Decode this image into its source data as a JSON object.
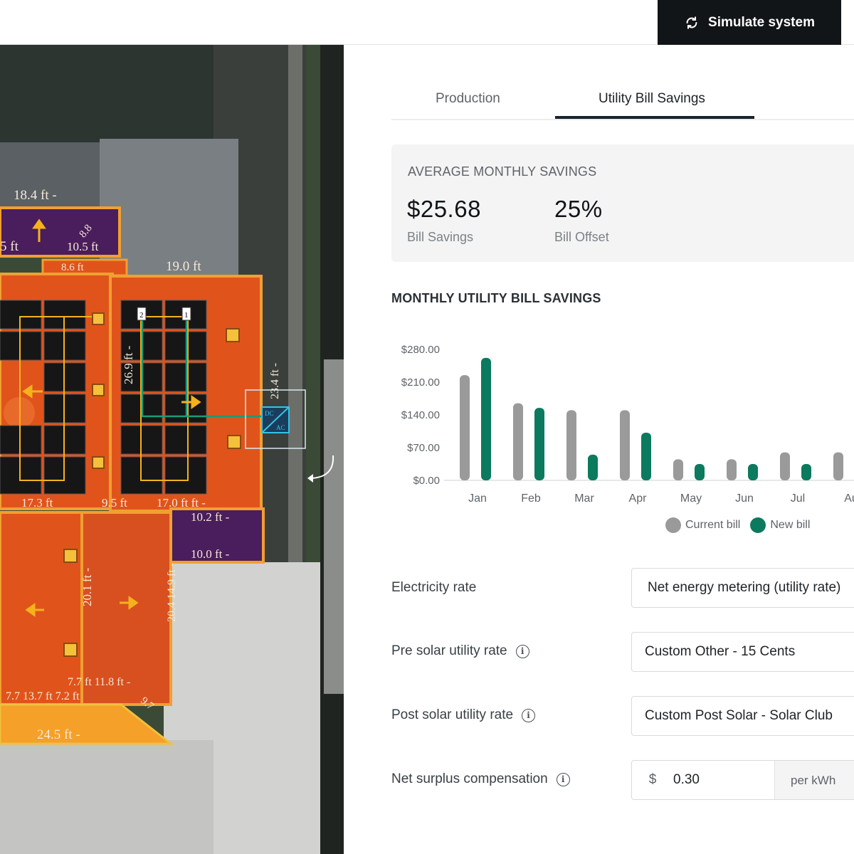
{
  "toolbar": {
    "simulate_label": "Simulate system"
  },
  "colors": {
    "current_bill": "#9a9a9a",
    "new_bill": "#0b7a5e",
    "dark": "#121517",
    "roof": "#e0541c",
    "solar_panel": "#161616"
  },
  "map": {
    "labels": {
      "l1": "18.4 ft -",
      "l2": "5 ft",
      "l3": "8.8",
      "l4": "10.5 ft",
      "l5": "8.6 ft",
      "l6": "19.0 ft",
      "l7": "26.9 ft -",
      "l8": "23.4 ft -",
      "l9": "17.3 ft",
      "l10": "9.5 ft",
      "l11": "17.0 ft ft -",
      "l12": "10.2 ft -",
      "l13": "10.0 ft -",
      "l14": "20.1 ft -",
      "l15": "20.4 14.9 ft -",
      "l16": "7.7 ft 11.8 ft -",
      "l17": "7.7 13.7 ft 7.2 ft",
      "l18": "9.7",
      "l19": "24.5 ft -",
      "string_1": "1",
      "string_2": "2",
      "inverter_dc": "DC",
      "inverter_ac": "AC"
    }
  },
  "tabs": [
    {
      "label": "Production",
      "active": false
    },
    {
      "label": "Utility Bill Savings",
      "active": true
    }
  ],
  "summary": {
    "title": "AVERAGE MONTHLY SAVINGS",
    "bill_savings_value": "$25.68",
    "bill_savings_label": "Bill Savings",
    "bill_offset_value": "25%",
    "bill_offset_label": "Bill Offset"
  },
  "chart_section_title": "MONTHLY UTILITY BILL SAVINGS",
  "chart_data": {
    "type": "bar",
    "categories": [
      "Jan",
      "Feb",
      "Mar",
      "Apr",
      "May",
      "Jun",
      "Jul",
      "Au"
    ],
    "series": [
      {
        "name": "Current bill",
        "values": [
          225,
          165,
          150,
          150,
          45,
          45,
          60,
          60
        ]
      },
      {
        "name": "New bill",
        "values": [
          262,
          155,
          55,
          102,
          35,
          35,
          35,
          0
        ]
      }
    ],
    "yticks": [
      "$280.00",
      "$210.00",
      "$140.00",
      "$70.00",
      "$0.00"
    ],
    "ylim": [
      0,
      280
    ],
    "grid": false,
    "legend": "bottom"
  },
  "legend": {
    "current": "Current bill",
    "new": "New bill"
  },
  "form": {
    "electricity_rate_label": "Electricity rate",
    "electricity_rate_value": "Net energy metering (utility rate)",
    "pre_solar_label": "Pre solar utility rate",
    "pre_solar_value": "Custom Other - 15 Cents",
    "post_solar_label": "Post solar utility rate",
    "post_solar_value": "Custom Post Solar - Solar Club",
    "nsc_label": "Net surplus compensation",
    "nsc_currency": "$",
    "nsc_value": "0.30",
    "nsc_unit": "per kWh",
    "info_glyph": "i"
  }
}
